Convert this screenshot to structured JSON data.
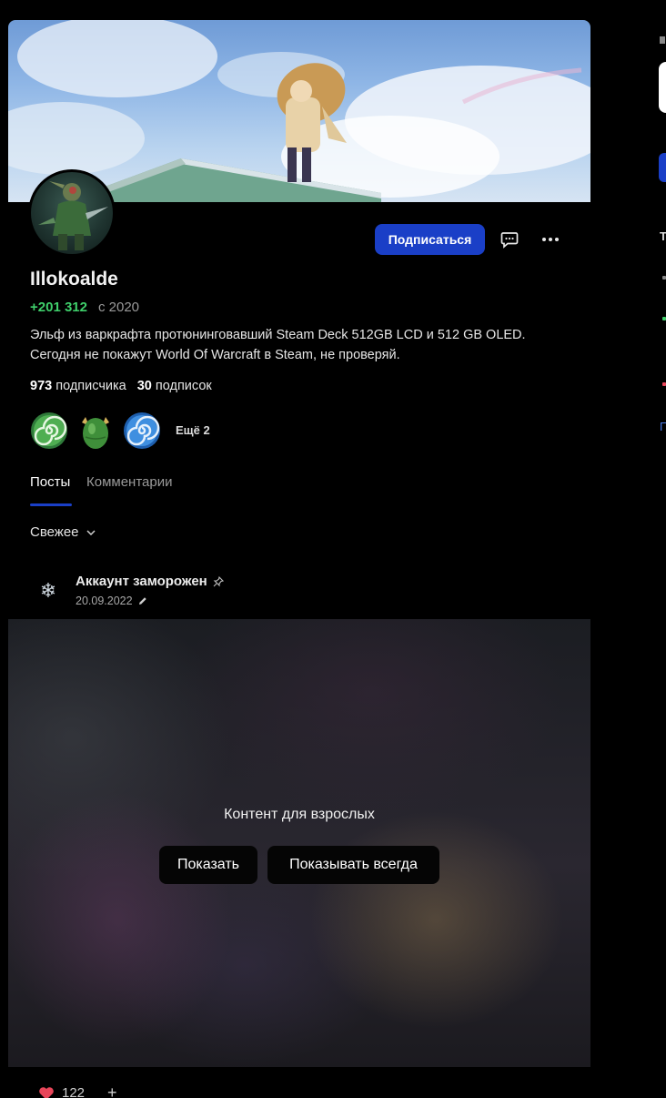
{
  "profile": {
    "username": "Illokoalde",
    "rating": "+201 312",
    "since": "с 2020",
    "bio_line1": "Эльф из варкрафта протюнинговавший Steam Deck 512GB LCD и 512 GB OLED.",
    "bio_line2": "Сегодня не покажут World Of Warcraft в Steam, не проверяй.",
    "followers_count": "973",
    "followers_label": "подписчика",
    "following_count": "30",
    "following_label": "подписок",
    "badges_more": "Ещё 2"
  },
  "actions": {
    "subscribe_label": "Подписаться"
  },
  "tabs": [
    {
      "label": "Посты",
      "active": true
    },
    {
      "label": "Комментарии",
      "active": false
    }
  ],
  "sort": {
    "label": "Свежее"
  },
  "post": {
    "title": "Аккаунт заморожен",
    "date": "20.09.2022",
    "nsfw_label": "Контент для взрослых",
    "show_label": "Показать",
    "show_always_label": "Показывать всегда",
    "likes": "122"
  },
  "sidebar": {
    "t_fragment": "Т",
    "link_fragment": "П"
  },
  "colors": {
    "accent": "#1a3fc7",
    "rating": "#3fcf6b",
    "background": "#000000"
  },
  "icons": [
    "comment-icon",
    "more-icon",
    "snowflake-icon",
    "pin-icon",
    "edit-icon",
    "chevron-down-icon",
    "heart-icon",
    "plus-icon"
  ]
}
